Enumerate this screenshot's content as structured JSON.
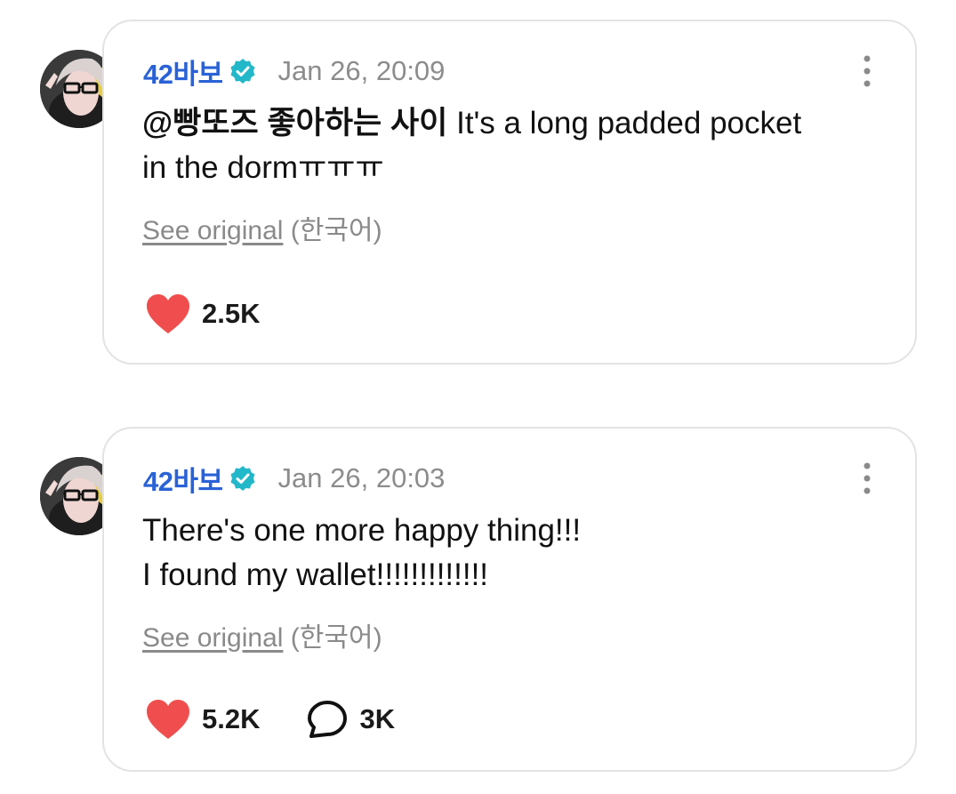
{
  "posts": [
    {
      "author": "42바보",
      "timestamp": "Jan 26, 20:09",
      "mention": "@빵또즈 좋아하는 사이",
      "lines": [
        "It's a long padded pocket",
        "in the dormㅠㅠㅠ"
      ],
      "see_original": "See original",
      "language": "(한국어)",
      "likes": "2.5K",
      "comments": null
    },
    {
      "author": "42바보",
      "timestamp": "Jan 26, 20:03",
      "mention": null,
      "lines": [
        "There's one more happy thing!!!",
        "I found my wallet!!!!!!!!!!!!!"
      ],
      "see_original": "See original",
      "language": "(한국어)",
      "likes": "5.2K",
      "comments": "3K"
    }
  ],
  "colors": {
    "author": "#2a62d6",
    "verified_badge": "#22b8c9",
    "heart": "#f04e4e",
    "timestamp": "#8c8c8c",
    "card_border": "#e3e3e3"
  },
  "icons": {
    "verified": "verified-badge-icon",
    "more": "more-vertical-icon",
    "like": "heart-icon",
    "comment": "comment-bubble-icon"
  }
}
